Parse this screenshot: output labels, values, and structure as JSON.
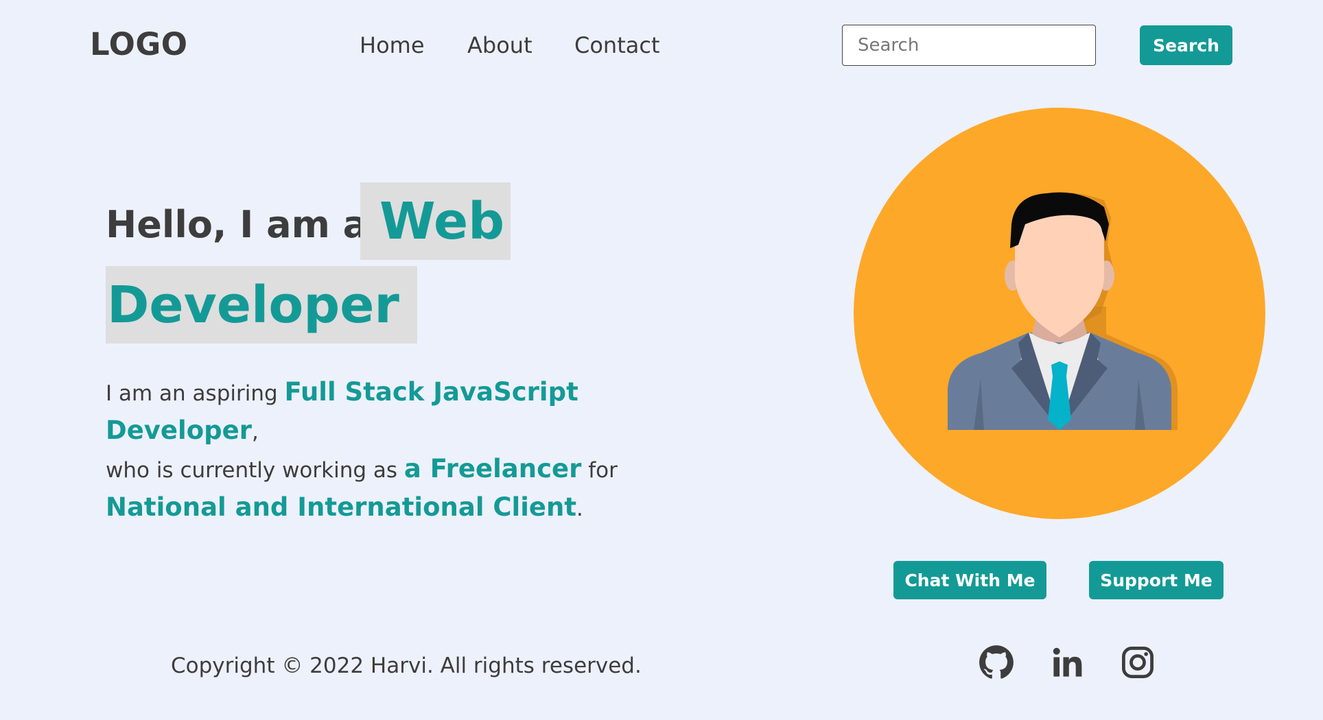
{
  "header": {
    "logo": "LOGO",
    "nav": [
      {
        "label": "Home"
      },
      {
        "label": "About"
      },
      {
        "label": "Contact"
      }
    ],
    "search": {
      "placeholder": "Search",
      "value": "",
      "button_label": "Search"
    }
  },
  "hero": {
    "greeting": "Hello, I am a",
    "role_part1": "Web",
    "role_part2": "Developer",
    "description": {
      "line1_prefix": "I am an aspiring ",
      "line1_highlight": "Full Stack JavaScript",
      "line2_highlight": "Developer",
      "line2_suffix": ",",
      "line3_prefix": "who is currently working as ",
      "line3_highlight": "a Freelancer",
      "line3_suffix": " for",
      "line4_highlight": "National and International Client",
      "line4_suffix": "."
    }
  },
  "actions": {
    "chat_label": "Chat With Me",
    "support_label": "Support Me"
  },
  "footer": {
    "copyright": "Copyright © 2022 Harvi. All rights reserved.",
    "social": [
      "github-icon",
      "linkedin-icon",
      "instagram-icon"
    ]
  },
  "colors": {
    "background": "#edf1fc",
    "accent": "#149a96",
    "highlight_bg": "#dedede",
    "avatar_circle": "#fea829",
    "text": "#3d3d3d"
  }
}
